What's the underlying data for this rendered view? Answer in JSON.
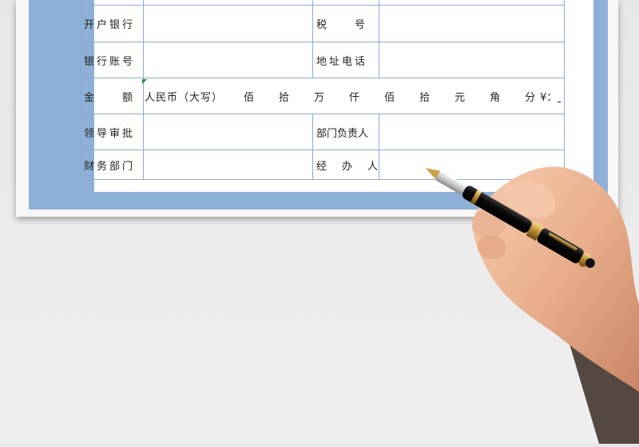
{
  "form": {
    "rows": [
      {
        "left_label": "",
        "right_label": ""
      },
      {
        "left_label": "开户银行",
        "right_label": "税　　号"
      },
      {
        "left_label": "银行账号",
        "right_label": "地址电话"
      },
      {
        "left_label": "金　　额",
        "right_label": ""
      },
      {
        "left_label": "领导审批",
        "right_label": "部门负责人"
      },
      {
        "left_label": "财务部门",
        "right_label": "经　办　人"
      }
    ],
    "amount": {
      "prefix": "人民币（大写）",
      "units": [
        "佰",
        "拾",
        "万",
        "仟",
        "佰",
        "拾",
        "元",
        "角",
        "分"
      ],
      "yen": "¥："
    }
  },
  "colors": {
    "border": "#8ea9d3",
    "frame": "#8fb0d6",
    "text": "#222222"
  }
}
